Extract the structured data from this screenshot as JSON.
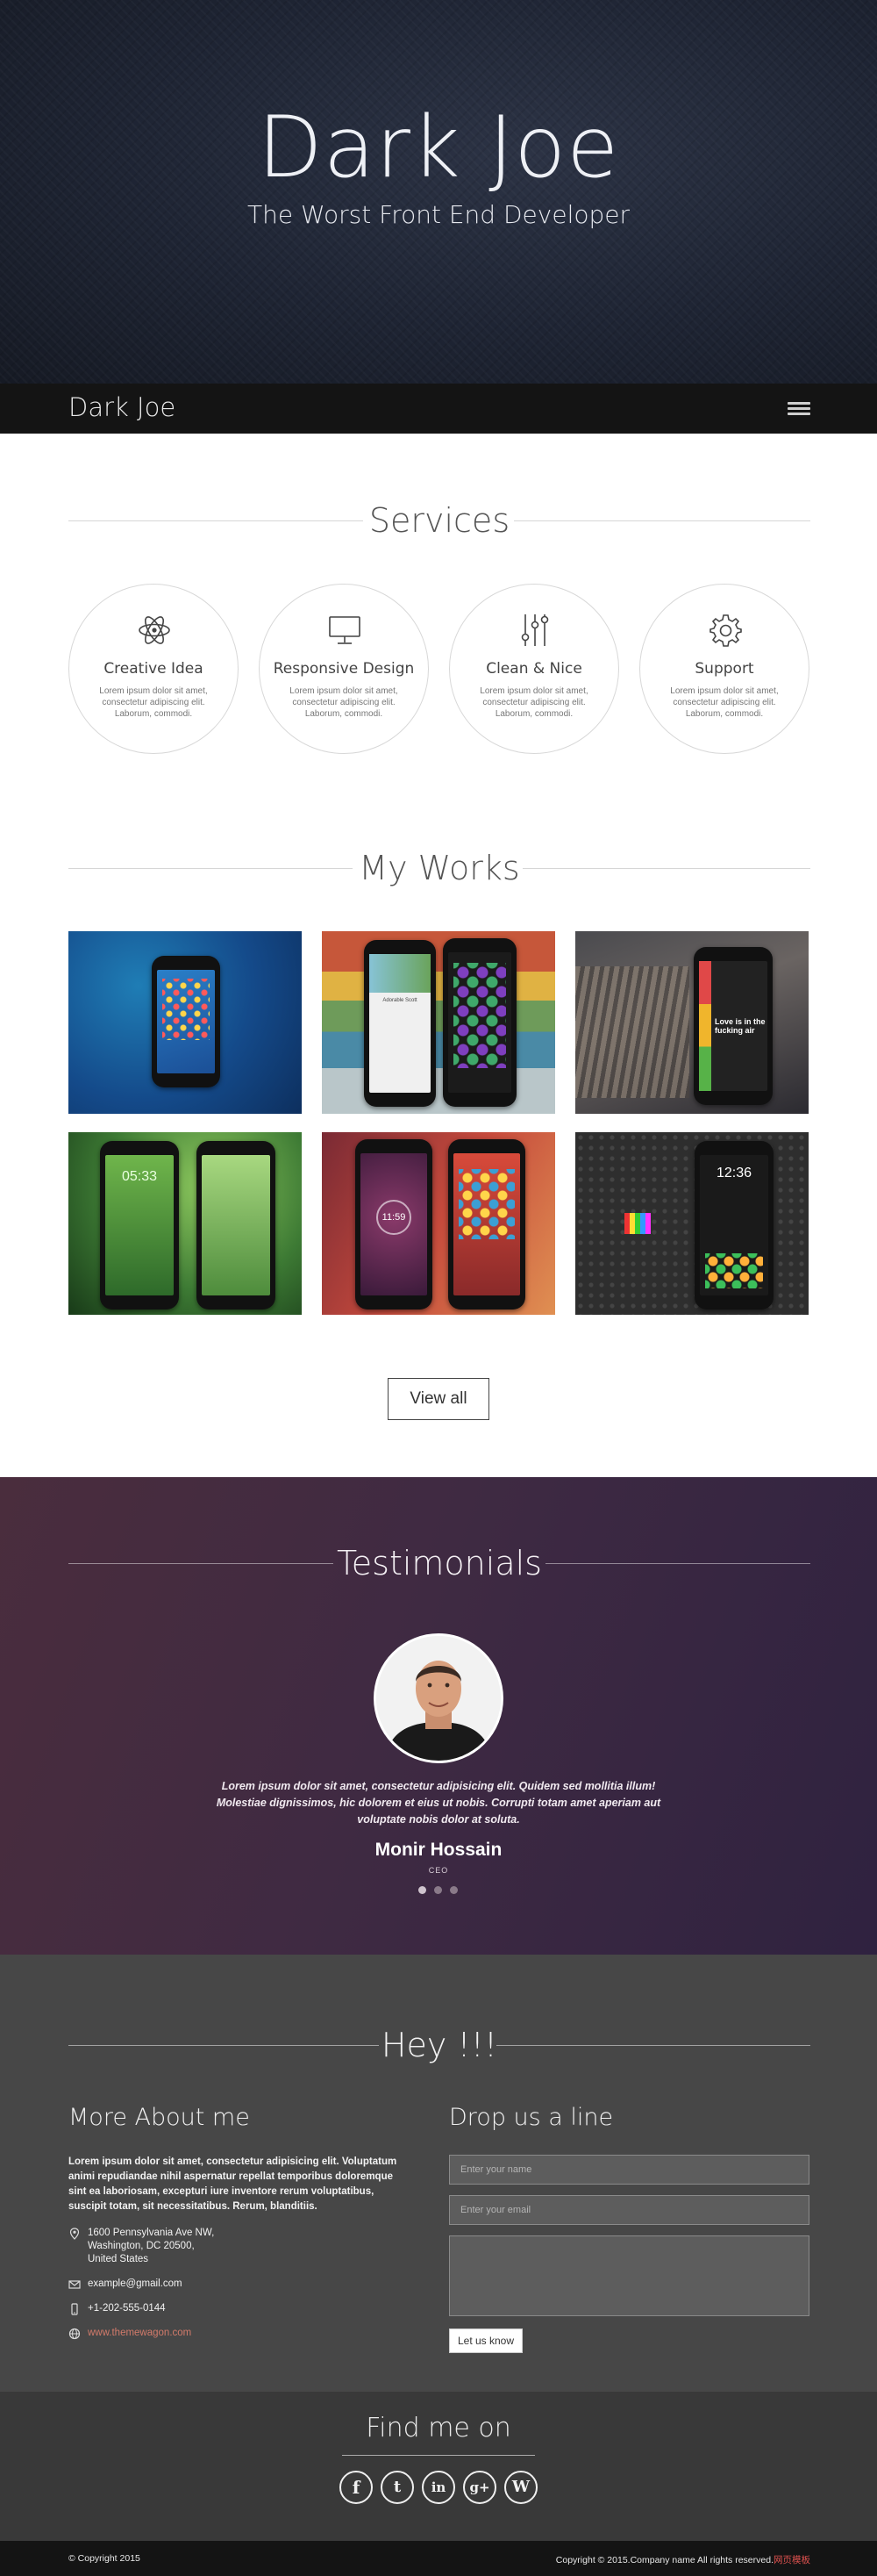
{
  "hero": {
    "title": "Dark Joe",
    "subtitle": "The Worst Front End Developer"
  },
  "nav": {
    "brand": "Dark Joe",
    "menu_icon": "hamburger-menu-icon"
  },
  "services": {
    "heading": "Services",
    "items": [
      {
        "icon": "atom-icon",
        "name": "Creative Idea",
        "desc": "Lorem ipsum dolor sit amet, consectetur adipiscing elit. Laborum, commodi."
      },
      {
        "icon": "monitor-icon",
        "name": "Responsive Design",
        "desc": "Lorem ipsum dolor sit amet, consectetur adipiscing elit. Laborum, commodi."
      },
      {
        "icon": "sliders-icon",
        "name": "Clean & Nice",
        "desc": "Lorem ipsum dolor sit amet, consectetur adipiscing elit. Laborum, commodi."
      },
      {
        "icon": "gear-icon",
        "name": "Support",
        "desc": "Lorem ipsum dolor sit amet, consectetur adipiscing elit. Laborum, commodi."
      }
    ]
  },
  "works": {
    "heading": "My Works",
    "view_all": "View all",
    "items": [
      {
        "thumb": "phone-blue-homescreen",
        "screen_texts": []
      },
      {
        "thumb": "two-phones-stripes",
        "screen_texts": [
          "Adorable Scott"
        ]
      },
      {
        "thumb": "phone-on-bench",
        "screen_texts": [
          "Love is in the fucking air"
        ]
      },
      {
        "thumb": "two-phones-green",
        "screen_texts": [
          "05:33"
        ]
      },
      {
        "thumb": "two-phones-red",
        "screen_texts": [
          "11:59"
        ]
      },
      {
        "thumb": "phone-dark-doodles",
        "screen_texts": [
          "12:36"
        ]
      }
    ]
  },
  "testimonials": {
    "heading": "Testimonials",
    "quote": "Lorem ipsum dolor sit amet, consectetur adipisicing elit. Quidem sed mollitia illum! Molestiae dignissimos, hic dolorem et eius ut nobis. Corrupti totam amet aperiam aut voluptate nobis dolor at soluta.",
    "name": "Monir Hossain",
    "role": "CEO",
    "active_slide": 1,
    "slide_count": 3
  },
  "contact": {
    "heading": "Hey !!!",
    "about_title": "More About me",
    "about_text": "Lorem ipsum dolor sit amet, consectetur adipisicing elit. Voluptatum animi repudiandae nihil aspernatur repellat temporibus doloremque sint ea laboriosam, excepturi iure inventore rerum voluptatibus, suscipit totam, sit necessitatibus. Rerum, blanditiis.",
    "address_lines": [
      "1600 Pennsylvania Ave NW,",
      "Washington, DC 20500,",
      "United States"
    ],
    "email": "example@gmail.com",
    "phone": "+1-202-555-0144",
    "website": "www.themewagon.com",
    "form_title": "Drop us a line",
    "name_placeholder": "Enter your name",
    "email_placeholder": "Enter your email",
    "message_placeholder": "",
    "submit": "Let us know"
  },
  "findme": {
    "title": "Find me on",
    "links": [
      {
        "icon": "facebook-icon",
        "glyph": "f"
      },
      {
        "icon": "twitter-icon",
        "glyph": "t"
      },
      {
        "icon": "linkedin-icon",
        "glyph": "in"
      },
      {
        "icon": "googleplus-icon",
        "glyph": "g+"
      },
      {
        "icon": "wordpress-icon",
        "glyph": "W"
      }
    ]
  },
  "footer": {
    "left": "© Copyright 2015",
    "right": "Copyright © 2015.Company name All rights reserved.",
    "right_highlight": "网页模板"
  },
  "colors": {
    "hero_bg": "#1e2433",
    "nav_bg": "#141414",
    "testimonial_bg": "#3f2a42",
    "contact_bg": "#474747",
    "findme_bg": "#393939",
    "link": "#d27a6a"
  }
}
